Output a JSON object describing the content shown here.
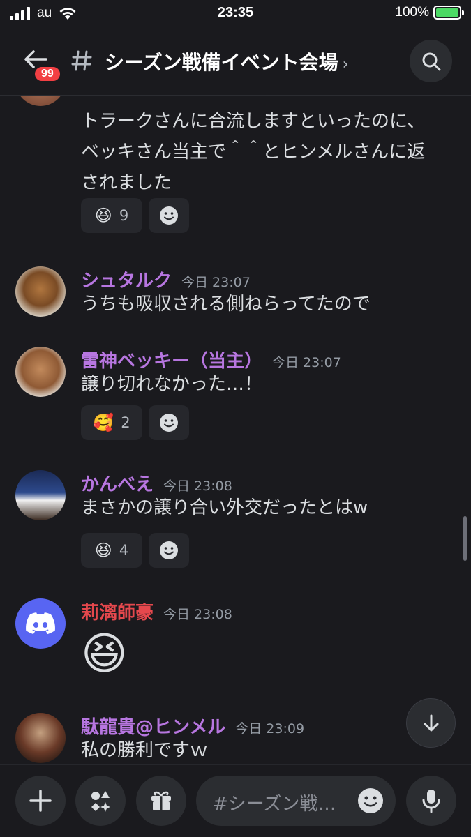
{
  "status_bar": {
    "carrier": "au",
    "time": "23:35",
    "battery": "100%"
  },
  "header": {
    "back_badge": "99",
    "channel_name": "シーズン戦備イベント会場",
    "chevron": "›"
  },
  "messages": [
    {
      "text": "トラークさんに合流しますといったのに、ベッキさん当主で＾＾とヒンメルさんに返されました",
      "reactions": [
        {
          "emoji": "😆",
          "count": "9"
        }
      ]
    },
    {
      "author": "シュタルク",
      "author_color": "#b776e0",
      "time": "今日 23:07",
      "text": "うちも吸収される側ねらってたので"
    },
    {
      "author": "雷神ベッキー（当主）",
      "author_color": "#b776e0",
      "time": "今日 23:07",
      "text": "譲り切れなかった…！",
      "reactions": [
        {
          "emoji": "🥰",
          "count": "2"
        }
      ]
    },
    {
      "author": "かんべえ",
      "author_color": "#b776e0",
      "time": "今日 23:08",
      "text": "まさかの譲り合い外交だったとはw",
      "reactions": [
        {
          "emoji": "😆",
          "count": "4"
        }
      ]
    },
    {
      "author": "莉漓師豪",
      "author_color": "#e5484d",
      "time": "今日 23:08",
      "emoji": "😆"
    },
    {
      "author": "駄龍貴@ヒンメル",
      "author_color": "#b776e0",
      "time": "今日 23:09",
      "text": "私の勝利ですｗ"
    }
  ],
  "composer": {
    "placeholder": "#シーズン戦…"
  },
  "colors": {
    "background": "#1a1a1e",
    "accent_badge": "#f23f43",
    "role_purple": "#b776e0",
    "role_red": "#e5484d"
  }
}
